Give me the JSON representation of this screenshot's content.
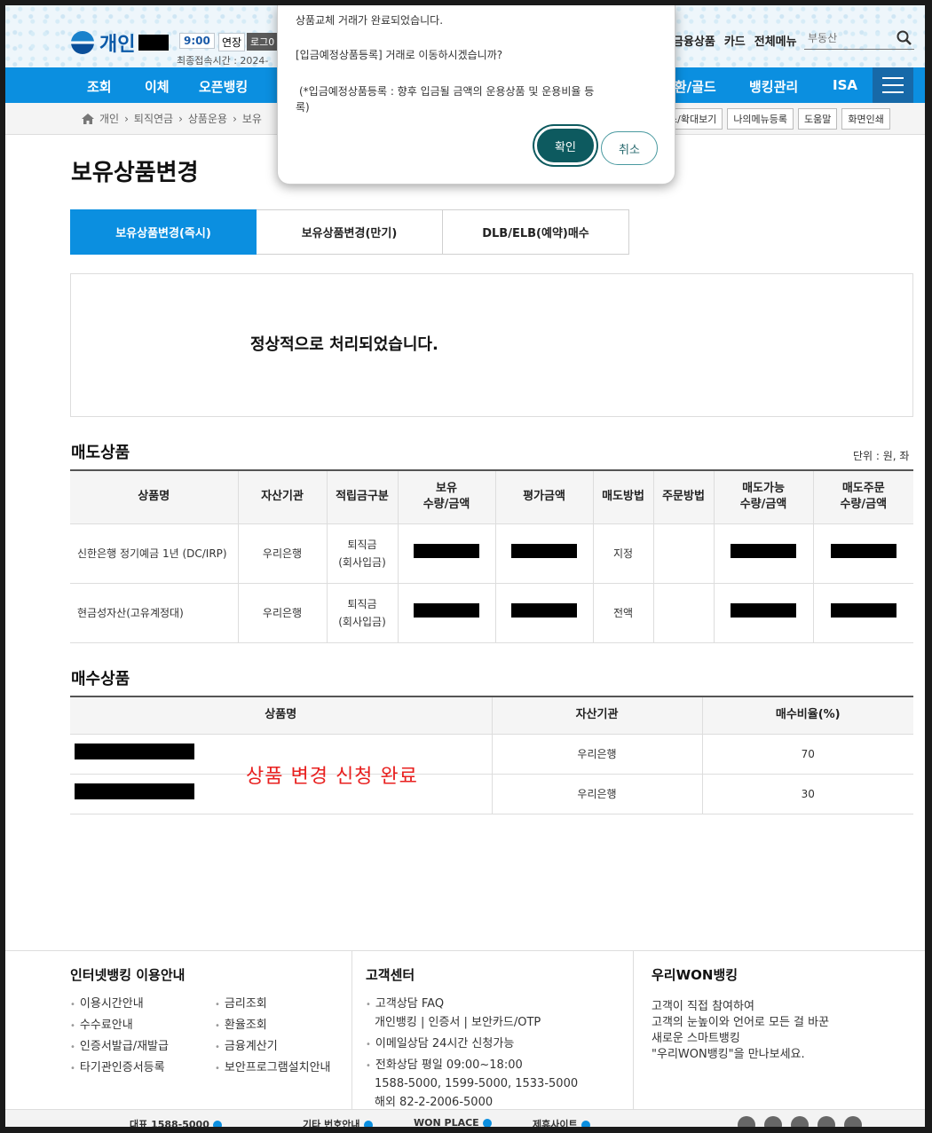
{
  "header": {
    "logo_text": "개인",
    "session_time": "9:00",
    "extend_label": "연장",
    "logout_label": "로그0",
    "last_login": "최종접속시간 :  2024-",
    "top_links": [
      "금융상품",
      "카드",
      "전체메뉴"
    ],
    "search_placeholder": "부동산"
  },
  "gnb": {
    "items": [
      "조회",
      "이체",
      "오픈뱅킹",
      "외환/골드",
      "뱅킹관리",
      "ISA"
    ]
  },
  "breadcrumb": [
    "개인",
    "퇴직연금",
    "상품운용",
    "보유"
  ],
  "util_buttons": [
    "소/확대보기",
    "나의메뉴등록",
    "도움말",
    "화면인쇄"
  ],
  "page": {
    "title": "보유상품변경",
    "tabs": [
      "보유상품변경(즉시)",
      "보유상품변경(만기)",
      "DLB/ELB(예약)매수"
    ],
    "result_message": "정상적으로 처리되었습니다."
  },
  "sell_section": {
    "title": "매도상품",
    "unit": "단위 : 원, 좌",
    "headers": [
      "상품명",
      "자산기관",
      "적립금구분",
      "보유\n수량/금액",
      "평가금액",
      "매도방법",
      "주문방법",
      "매도가능\n수량/금액",
      "매도주문\n수량/금액"
    ],
    "rows": [
      {
        "name": "신한은행 정기예금 1년 (DC/IRP)",
        "institution": "우리은행",
        "category": "퇴직금\n(회사입금)",
        "method": "지정"
      },
      {
        "name": "현금성자산(고유계정대)",
        "institution": "우리은행",
        "category": "퇴직금\n(회사입금)",
        "method": "전액"
      }
    ]
  },
  "buy_section": {
    "title": "매수상품",
    "headers": [
      "상품명",
      "자산기관",
      "매수비율(%)"
    ],
    "rows": [
      {
        "institution": "우리은행",
        "ratio": "70"
      },
      {
        "institution": "우리은행",
        "ratio": "30"
      }
    ],
    "annotation": "상품 변경 신청 완료"
  },
  "footer": {
    "col1": {
      "title": "인터넷뱅킹 이용안내",
      "left": [
        "이용시간안내",
        "수수료안내",
        "인증서발급/재발급",
        "타기관인증서등록"
      ],
      "right": [
        "금리조회",
        "환율조회",
        "금융계산기",
        "보안프로그램설치안내"
      ]
    },
    "col2": {
      "title": "고객센터",
      "faq": "고객상담 FAQ",
      "faq_links": "개인뱅킹 | 인증서 | 보안카드/OTP",
      "email": "이메일상담 24시간 신청가능",
      "phone": "전화상담 평일 09:00~18:00",
      "phone_numbers": "1588-5000, 1599-5000, 1533-5000",
      "overseas": "해외 82-2-2006-5000"
    },
    "col3": {
      "title": "우리WON뱅킹",
      "desc": "고객이 직접 참여하여\n고객의 눈높이와 언어로 모든 걸 바꾼\n새로운 스마트뱅킹\n\"우리WON뱅킹\"을 만나보세요."
    },
    "strip": [
      "대표 1588-5000",
      "기타 번호안내",
      "WON PLACE",
      "제휴사이트"
    ]
  },
  "dialog": {
    "line1": "상품교체 거래가 완료되었습니다.",
    "line2": "[입금예정상품등록] 거래로 이동하시겠습니까?",
    "line3": "(*입금예정상품등록 : 향후 입금될 금액의 운용상품 및 운용비율 등",
    "line4": "록)",
    "ok_label": "확인",
    "cancel_label": "취소"
  },
  "colors": {
    "gnb_blue": "#0b8fe0",
    "dialog_ok": "#0d5a5f",
    "annotation_red": "#e8201f"
  }
}
